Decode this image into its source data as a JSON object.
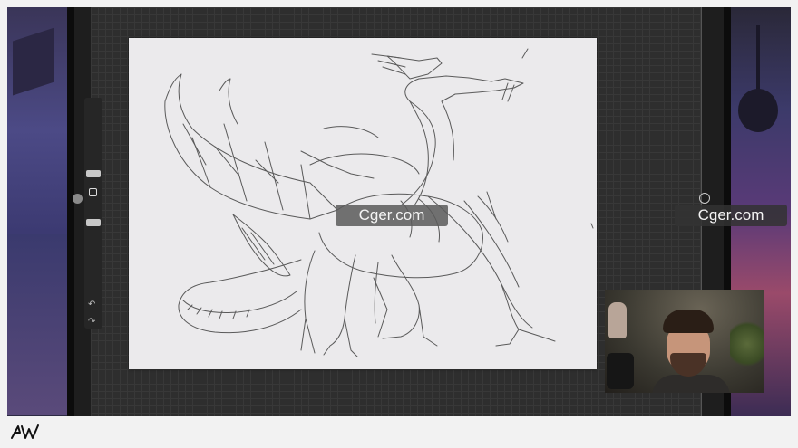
{
  "watermark": {
    "text": "Cger.com"
  },
  "icons": {
    "undo": "↶",
    "redo": "↷"
  },
  "colors": {
    "canvas": "#ebeaec",
    "workspace": "#2e2e2e",
    "watermark_bg": "#5a5a5a"
  }
}
